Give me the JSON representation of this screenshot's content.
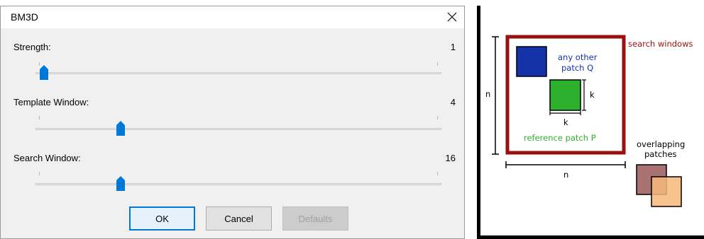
{
  "dialog": {
    "title": "BM3D",
    "sliders": [
      {
        "label": "Strength:",
        "value": "1",
        "level": 0.01
      },
      {
        "label": "Template Window:",
        "value": "4",
        "level": 0.2
      },
      {
        "label": "Search Window:",
        "value": "16",
        "level": 0.2
      }
    ],
    "buttons": {
      "ok": "OK",
      "cancel": "Cancel",
      "defaults": "Defaults"
    }
  },
  "diagram": {
    "search_windows_label": "search windows",
    "other_patch_label_1": "any other",
    "other_patch_label_2": "patch Q",
    "reference_patch_label": "reference patch P",
    "patch_size_label": "k",
    "window_size_label": "n",
    "overlap_label_1": "overlapping",
    "overlap_label_2": "patches",
    "colors": {
      "search_window": "#9b0f0f",
      "patch_q": "#1433a8",
      "patch_p": "#2db02d",
      "overlap_a": "#a87272",
      "overlap_b": "#f5b97a",
      "slider_thumb": "#0078d7"
    }
  }
}
